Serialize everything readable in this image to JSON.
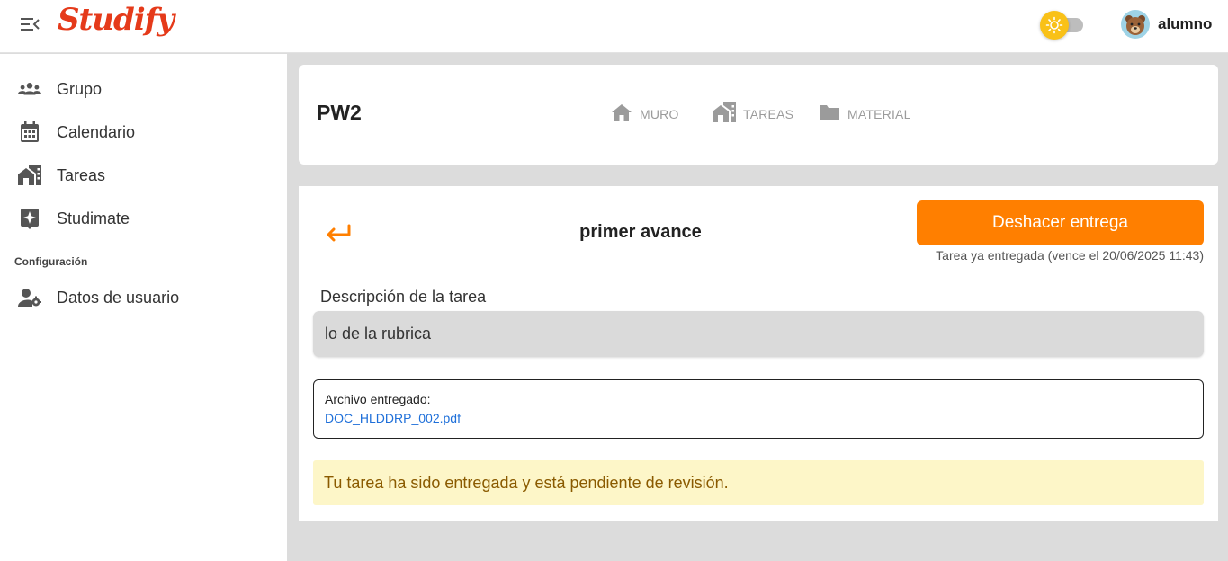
{
  "app": {
    "logo_text": "Studify",
    "brand_color": "#e53a1a"
  },
  "header": {
    "menu_icon": "menu-collapse-icon",
    "theme_icon": "sun-icon",
    "username": "alumno",
    "avatar_icon": "bear-avatar"
  },
  "sidebar": {
    "items": [
      {
        "label": "Grupo",
        "icon": "group-icon"
      },
      {
        "label": "Calendario",
        "icon": "calendar-icon"
      },
      {
        "label": "Tareas",
        "icon": "tasks-icon"
      },
      {
        "label": "Studimate",
        "icon": "sparkle-icon"
      }
    ],
    "section_label": "Configuración",
    "settings_items": [
      {
        "label": "Datos de usuario",
        "icon": "user-settings-icon"
      }
    ]
  },
  "course": {
    "title": "PW2",
    "tabs": [
      {
        "label": "MURO",
        "icon": "home-icon"
      },
      {
        "label": "TAREAS",
        "icon": "tasks-icon"
      },
      {
        "label": "MATERIAL",
        "icon": "folder-icon"
      }
    ]
  },
  "task": {
    "back_icon": "return-arrow-icon",
    "title": "primer avance",
    "undo_button": "Deshacer entrega",
    "due_note": "Tarea ya entregada (vence el 20/06/2025 11:43)",
    "description_label": "Descripción de la tarea",
    "description": "lo de la rubrica",
    "file_label": "Archivo entregado:",
    "file_name": "DOC_HLDDRP_002.pdf",
    "status": "Tu tarea ha sido entregada y está pendiente de revisión."
  },
  "colors": {
    "accent": "#ff7f00",
    "status_bg": "#fdf6c8",
    "status_text": "#8a5a00",
    "link": "#1e6fd9"
  }
}
